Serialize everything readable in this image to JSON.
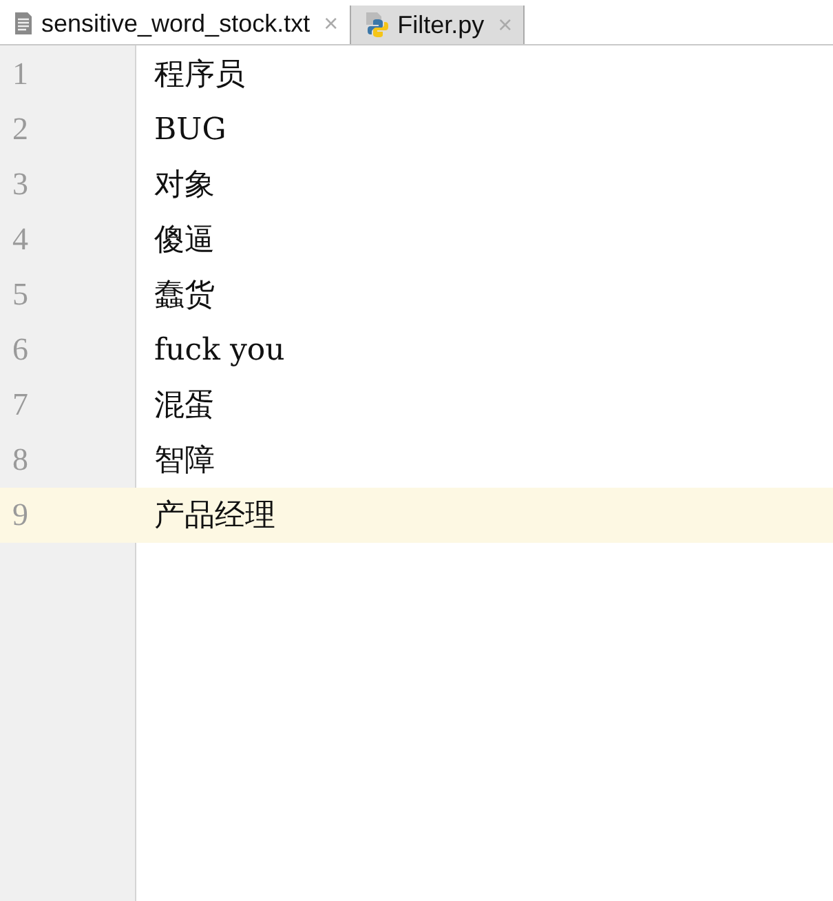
{
  "tabs": [
    {
      "label": "sensitive_word_stock.txt",
      "kind": "text",
      "selected": true,
      "close": "×"
    },
    {
      "label": "Filter.py",
      "kind": "python",
      "selected": false,
      "close": "×"
    }
  ],
  "editor": {
    "lines": [
      {
        "number": "1",
        "text": "程序员",
        "current": false
      },
      {
        "number": "2",
        "text": "BUG",
        "current": false
      },
      {
        "number": "3",
        "text": "对象",
        "current": false
      },
      {
        "number": "4",
        "text": "傻逼",
        "current": false
      },
      {
        "number": "5",
        "text": "蠢货",
        "current": false
      },
      {
        "number": "6",
        "text": "fuck you",
        "current": false
      },
      {
        "number": "7",
        "text": "混蛋",
        "current": false
      },
      {
        "number": "8",
        "text": "智障",
        "current": false
      },
      {
        "number": "9",
        "text": "产品经理",
        "current": true
      }
    ]
  }
}
